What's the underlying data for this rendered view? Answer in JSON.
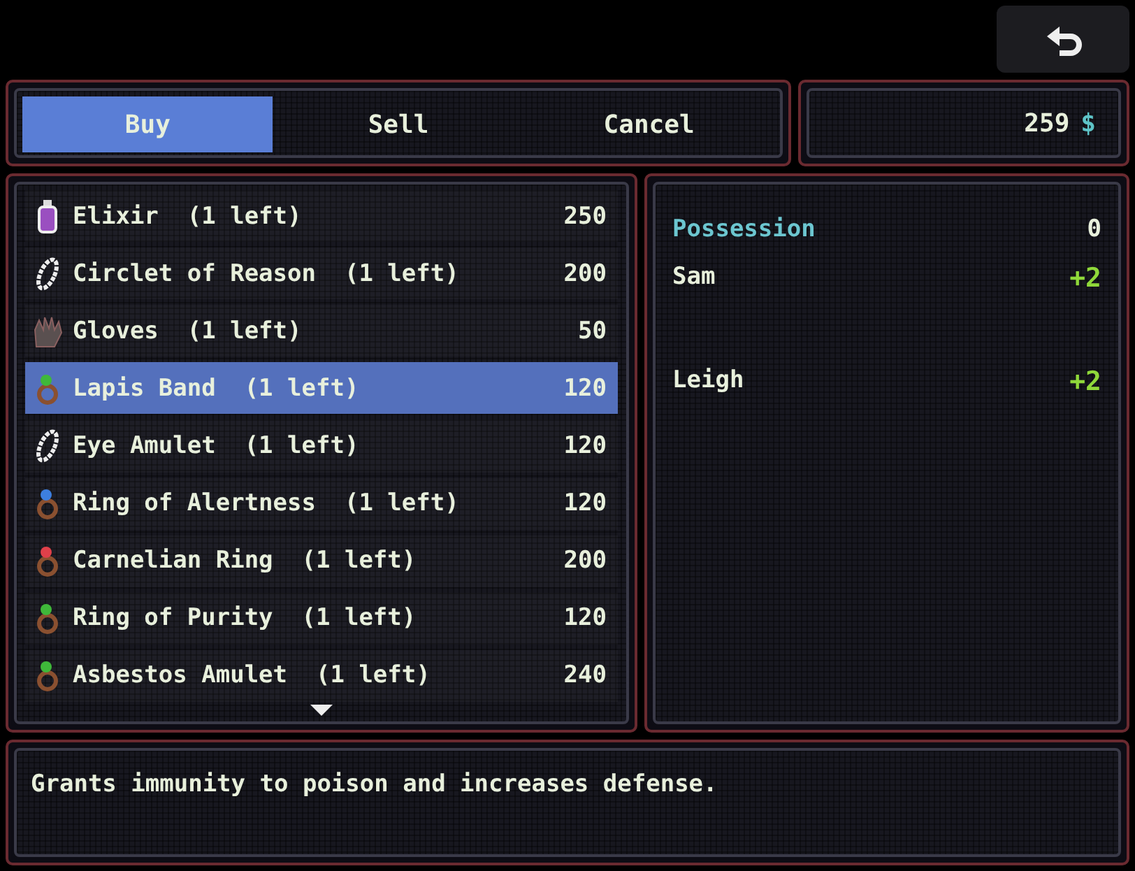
{
  "tabs": [
    {
      "label": "Buy",
      "selected": true
    },
    {
      "label": "Sell",
      "selected": false
    },
    {
      "label": "Cancel",
      "selected": false
    }
  ],
  "money": {
    "amount": "259",
    "currency": "$"
  },
  "items": [
    {
      "name": "Elixir  (1 left)",
      "price": "250",
      "kind": "potion",
      "selected": false
    },
    {
      "name": "Circlet of Reason  (1 left)",
      "price": "200",
      "kind": "circlet",
      "selected": false
    },
    {
      "name": "Gloves  (1 left)",
      "price": "50",
      "kind": "gloves",
      "selected": false
    },
    {
      "name": "Lapis Band  (1 left)",
      "price": "120",
      "kind": "ring",
      "color": "#3fb83a",
      "selected": true
    },
    {
      "name": "Eye Amulet  (1 left)",
      "price": "120",
      "kind": "circlet",
      "selected": false
    },
    {
      "name": "Ring of Alertness  (1 left)",
      "price": "120",
      "kind": "ring",
      "color": "#3d7fe0",
      "selected": false
    },
    {
      "name": "Carnelian Ring  (1 left)",
      "price": "200",
      "kind": "ring",
      "color": "#e0404a",
      "selected": false
    },
    {
      "name": "Ring of Purity  (1 left)",
      "price": "120",
      "kind": "ring",
      "color": "#3fb83a",
      "selected": false
    },
    {
      "name": "Asbestos Amulet  (1 left)",
      "price": "240",
      "kind": "ring",
      "color": "#3fb83a",
      "selected": false
    }
  ],
  "stats": [
    {
      "label": "Possession",
      "value": "0",
      "kind": "header"
    },
    {
      "label": "Sam",
      "value": "+2",
      "kind": "stat"
    },
    {
      "label": "Leigh",
      "value": "+2",
      "kind": "stat"
    }
  ],
  "description": "Grants immunity to poison and increases defense."
}
